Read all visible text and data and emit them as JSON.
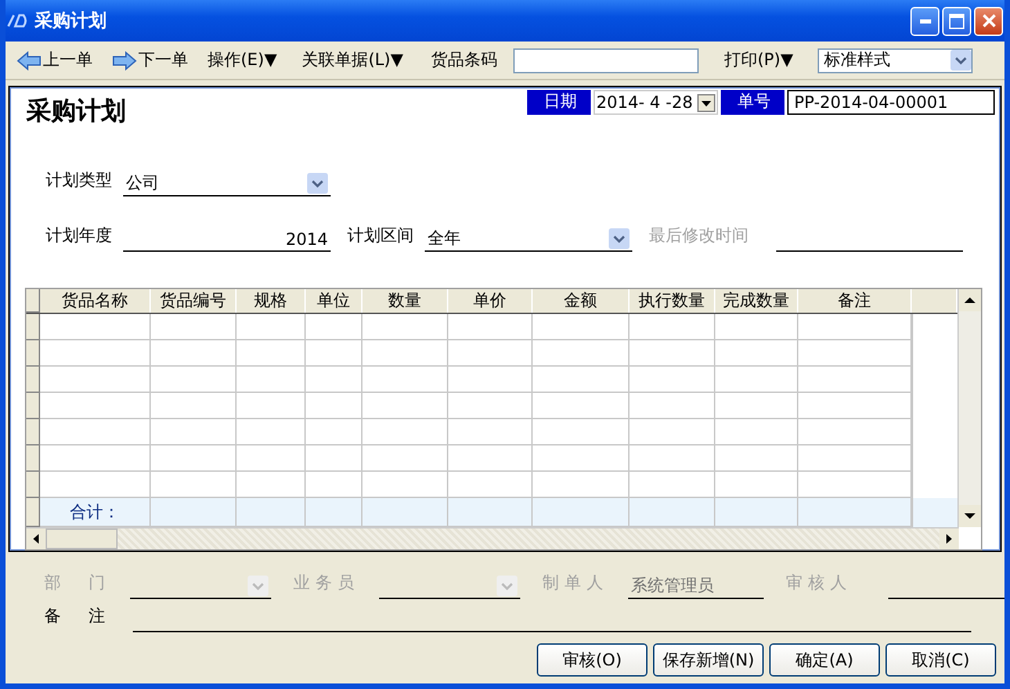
{
  "window": {
    "title": "采购计划"
  },
  "toolbar": [
    {
      "kind": "back",
      "label": "上一单"
    },
    {
      "kind": "forward",
      "label": "下一单"
    },
    {
      "kind": "menu",
      "label": "操作(E)▼"
    },
    {
      "kind": "menu",
      "label": "关联单据(L)▼"
    },
    {
      "kind": "label",
      "label": "货品条码"
    },
    {
      "kind": "input"
    },
    {
      "kind": "menu",
      "label": "打印(P)▼"
    },
    {
      "kind": "select",
      "label": "标准样式"
    }
  ],
  "form": {
    "heading": "采购计划",
    "date_label": "日期",
    "date": "2014- 4 -28",
    "number_label": "单号",
    "number": "PP-2014-04-00001"
  },
  "fields_row1": [
    {
      "label": "计划类型",
      "value": "公司",
      "kind": "combo",
      "disabled": false
    }
  ],
  "fields_row2": [
    {
      "label": "计划年度",
      "value": "2014",
      "kind": "number",
      "disabled": false
    },
    {
      "label": "计划区间",
      "value": "全年",
      "kind": "combo",
      "disabled": false
    },
    {
      "label": "最后修改时间",
      "kind": "text",
      "disabled": true
    }
  ],
  "table": {
    "columns": [
      "货品名称",
      "货品编号",
      "规格",
      "单位",
      "数量",
      "单价",
      "金额",
      "执行数量",
      "完成数量",
      "备注"
    ],
    "total_label": "合计："
  },
  "footer_fields": [
    {
      "label": "部　门",
      "kind": "combo",
      "disabled": true
    },
    {
      "label": "业务员",
      "kind": "combo",
      "disabled": true
    },
    {
      "label": "制单人",
      "value": "系统管理员",
      "kind": "text",
      "disabled": true
    },
    {
      "label": "审核人",
      "kind": "text",
      "disabled": true
    }
  ],
  "remark": {
    "label": "备　注"
  },
  "buttons": [
    "审核(O)",
    "保存新增(N)",
    "确定(A)",
    "取消(C)"
  ]
}
